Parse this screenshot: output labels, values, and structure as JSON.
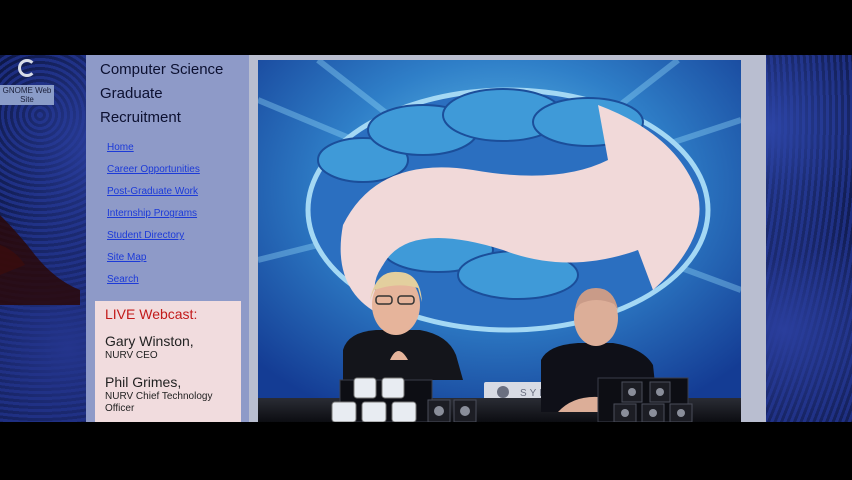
{
  "desktop": {
    "icon_label": "GNOME Web Site",
    "icon_name": "gnome-foot-icon"
  },
  "sidebar": {
    "title": "Computer Science Graduate Recruitment",
    "nav": [
      "Home",
      "Career Opportunities",
      "Post-Graduate Work",
      "Internship Programs",
      "Student Directory",
      "Site Map",
      "Search"
    ]
  },
  "webcast": {
    "heading": "LIVE Webcast:",
    "presenters": [
      {
        "name": "Gary Winston,",
        "role": "NURV CEO"
      },
      {
        "name": "Phil Grimes,",
        "role": "NURV Chief Technology Officer"
      }
    ]
  },
  "video": {
    "banner_text": "SYNAPSE"
  },
  "colors": {
    "link": "#1c3ad8",
    "live": "#c21a1a",
    "panel": "#8e9ac8",
    "webcast_bg": "#f1dcde"
  }
}
